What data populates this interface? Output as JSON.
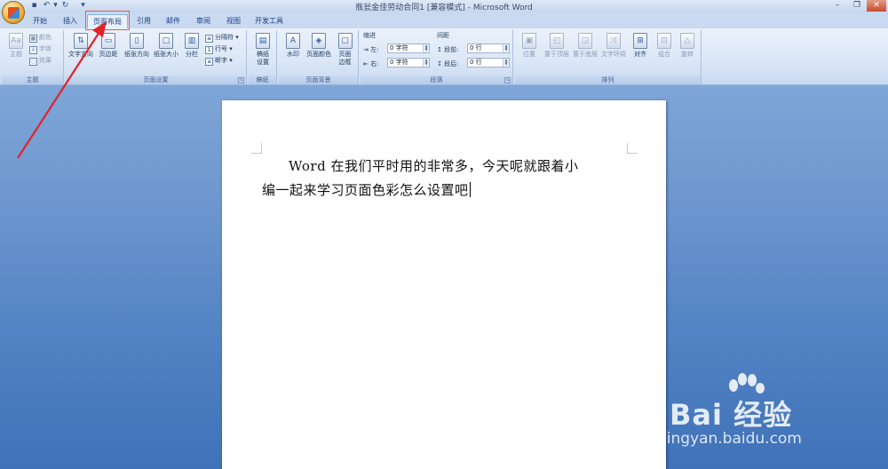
{
  "window": {
    "title": "瓶瓮金佳劳动合同1 [兼容模式] - Microsoft Word"
  },
  "tabs": [
    "开始",
    "插入",
    "页面布局",
    "引用",
    "邮件",
    "审阅",
    "视图",
    "开发工具"
  ],
  "active_tab": "页面布局",
  "ribbon": {
    "theme": {
      "label": "主题",
      "big": "主题",
      "items": [
        "颜色",
        "字体",
        "效果"
      ]
    },
    "page_setup": {
      "label": "页面设置",
      "big": [
        "文字方向",
        "页边距",
        "纸张方向",
        "纸张大小",
        "分栏"
      ],
      "small": [
        "分隔符",
        "行号",
        "断字"
      ]
    },
    "draft": {
      "label": "稿纸",
      "big_line1": "稿纸",
      "big_line2": "设置"
    },
    "page_background": {
      "label": "页面背景",
      "big": [
        "水印",
        "页面颜色"
      ],
      "border_line1": "页面",
      "border_line2": "边框"
    },
    "paragraph": {
      "label": "段落",
      "indent_title": "缩进",
      "spacing_title": "间距",
      "left_label": "左:",
      "left_value": "0 字符",
      "right_label": "右:",
      "right_value": "0 字符",
      "before_label": "段前:",
      "before_value": "0 行",
      "after_label": "段后:",
      "after_value": "0 行"
    },
    "arrange": {
      "label": "排列",
      "big": [
        "位置",
        "置于顶层",
        "置于底层",
        "文字环绕",
        "对齐",
        "组合",
        "旋转"
      ]
    }
  },
  "document": {
    "line1": "Word 在我们平时用的非常多，今天呢就跟着小",
    "line2": "编一起来学习页面色彩怎么设置吧"
  },
  "watermark": {
    "brand": "Bai 经验",
    "url": "jingyan.baidu.com"
  }
}
